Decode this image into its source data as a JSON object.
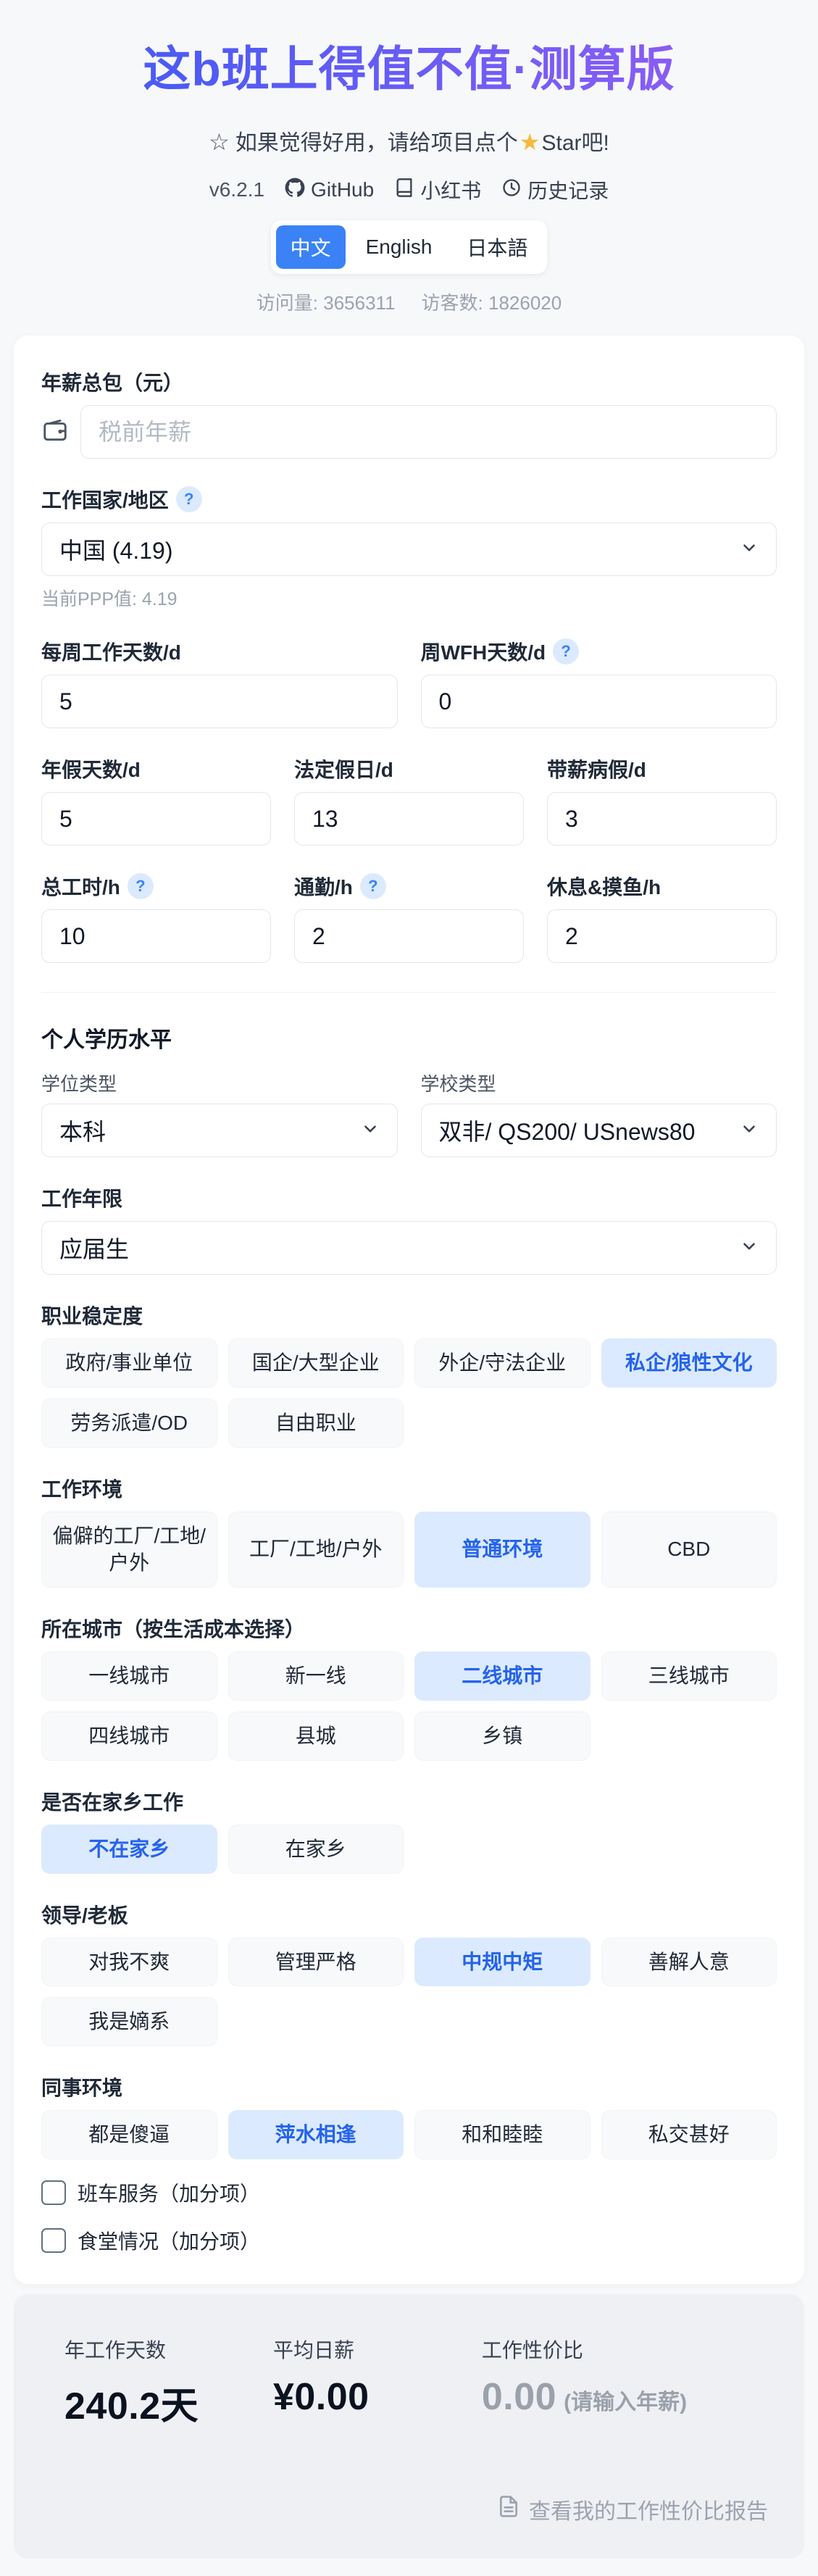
{
  "colors": {
    "accent": "#3b82f6",
    "selected_bg": "#dbeafe",
    "selected_text": "#2563eb",
    "grad_from": "#4b5bf5",
    "grad_to": "#8b5cf6",
    "star": "#f6b93b"
  },
  "header": {
    "title": "这b班上得值不值·测算版",
    "star_note": "如果觉得好用，请给项目点个",
    "star_suffix": "Star吧!",
    "version": "v6.2.1",
    "links": [
      {
        "icon": "github-icon",
        "label": "GitHub"
      },
      {
        "icon": "book-icon",
        "label": "小红书"
      },
      {
        "icon": "history-icon",
        "label": "历史记录"
      }
    ],
    "languages": [
      {
        "label": "中文",
        "active": true
      },
      {
        "label": "English",
        "active": false
      },
      {
        "label": "日本語",
        "active": false
      }
    ],
    "stats": {
      "visits_label": "访问量:",
      "visits": "3656311",
      "visitors_label": "访客数:",
      "visitors": "1826020"
    }
  },
  "form": {
    "salary": {
      "label": "年薪总包（元）",
      "placeholder": "税前年薪",
      "value": ""
    },
    "country": {
      "label": "工作国家/地区",
      "value": "中国 (4.19)",
      "help": "当前PPP值: 4.19"
    },
    "inputs": [
      {
        "label": "每周工作天数/d",
        "value": "5",
        "tooltip": false
      },
      {
        "label": "周WFH天数/d",
        "value": "0",
        "tooltip": true
      },
      {
        "label": "年假天数/d",
        "value": "5",
        "tooltip": false
      },
      {
        "label": "法定假日/d",
        "value": "13",
        "tooltip": false
      },
      {
        "label": "带薪病假/d",
        "value": "3",
        "tooltip": false
      },
      {
        "label": "总工时/h",
        "value": "10",
        "tooltip": true
      },
      {
        "label": "通勤/h",
        "value": "2",
        "tooltip": true
      },
      {
        "label": "休息&摸鱼/h",
        "value": "2",
        "tooltip": false
      }
    ],
    "education": {
      "title": "个人学历水平",
      "degree_label": "学位类型",
      "degree_value": "本科",
      "school_label": "学校类型",
      "school_value": "双非/ QS200/ USnews80"
    },
    "experience": {
      "label": "工作年限",
      "value": "应届生"
    },
    "groups": [
      {
        "label": "职业稳定度",
        "options": [
          "政府/事业单位",
          "国企/大型企业",
          "外企/守法企业",
          "私企/狼性文化",
          "劳务派遣/OD",
          "自由职业"
        ],
        "selected": 3
      },
      {
        "label": "工作环境",
        "options": [
          "偏僻的工厂/工地/户外",
          "工厂/工地/户外",
          "普通环境",
          "CBD"
        ],
        "selected": 2
      },
      {
        "label": "所在城市（按生活成本选择）",
        "options": [
          "一线城市",
          "新一线",
          "二线城市",
          "三线城市",
          "四线城市",
          "县城",
          "乡镇"
        ],
        "selected": 2
      },
      {
        "label": "是否在家乡工作",
        "options": [
          "不在家乡",
          "在家乡"
        ],
        "selected": 0
      },
      {
        "label": "领导/老板",
        "options": [
          "对我不爽",
          "管理严格",
          "中规中矩",
          "善解人意",
          "我是嫡系"
        ],
        "selected": 2
      },
      {
        "label": "同事环境",
        "options": [
          "都是傻逼",
          "萍水相逢",
          "和和睦睦",
          "私交甚好"
        ],
        "selected": 1
      }
    ],
    "checkboxes": [
      {
        "label": "班车服务（加分项）",
        "checked": false
      },
      {
        "label": "食堂情况（加分项）",
        "checked": false
      }
    ]
  },
  "summary": {
    "items": [
      {
        "label": "年工作天数",
        "value": "240.2天"
      },
      {
        "label": "平均日薪",
        "value": "¥0.00"
      },
      {
        "label": "工作性价比",
        "value": "0.00",
        "note": "(请输入年薪)"
      }
    ],
    "report_link": "查看我的工作性价比报告"
  }
}
